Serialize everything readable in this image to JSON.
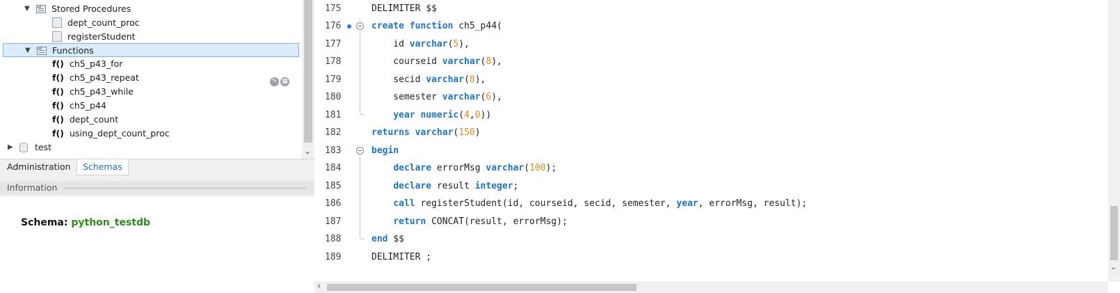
{
  "tree": {
    "stored_procedures": {
      "label": "Stored Procedures",
      "items": [
        "dept_count_proc",
        "registerStudent"
      ]
    },
    "functions": {
      "label": "Functions",
      "items": [
        "ch5_p43_for",
        "ch5_p43_repeat",
        "ch5_p43_while",
        "ch5_p44",
        "dept_count",
        "using_dept_count_proc"
      ]
    },
    "function_icon_text": "f()",
    "schema_test": "test"
  },
  "tabs": {
    "administration": "Administration",
    "schemas": "Schemas"
  },
  "information": {
    "header": "Information",
    "schema_label": "Schema:",
    "schema_value": "python_testdb"
  },
  "editor": {
    "line_numbers": [
      "175",
      "176",
      "177",
      "178",
      "179",
      "180",
      "181",
      "182",
      "183",
      "184",
      "185",
      "186",
      "187",
      "188",
      "189"
    ],
    "colors": {
      "keyword": "#1d74c2",
      "number": "#e08a19",
      "text": "#222222"
    },
    "lines": [
      [
        {
          "t": "pl",
          "v": "DELIMITER $$"
        }
      ],
      [
        {
          "t": "kw",
          "v": "create"
        },
        {
          "t": "pl",
          "v": " "
        },
        {
          "t": "kw",
          "v": "function"
        },
        {
          "t": "pl",
          "v": " ch5_p44("
        }
      ],
      [
        {
          "t": "pl",
          "v": "    id "
        },
        {
          "t": "ty",
          "v": "varchar"
        },
        {
          "t": "pl",
          "v": "("
        },
        {
          "t": "num",
          "v": "5"
        },
        {
          "t": "pl",
          "v": "),"
        }
      ],
      [
        {
          "t": "pl",
          "v": "    courseid "
        },
        {
          "t": "ty",
          "v": "varchar"
        },
        {
          "t": "pl",
          "v": "("
        },
        {
          "t": "num",
          "v": "8"
        },
        {
          "t": "pl",
          "v": "),"
        }
      ],
      [
        {
          "t": "pl",
          "v": "    secid "
        },
        {
          "t": "ty",
          "v": "varchar"
        },
        {
          "t": "pl",
          "v": "("
        },
        {
          "t": "num",
          "v": "8"
        },
        {
          "t": "pl",
          "v": "),"
        }
      ],
      [
        {
          "t": "pl",
          "v": "    semester "
        },
        {
          "t": "ty",
          "v": "varchar"
        },
        {
          "t": "pl",
          "v": "("
        },
        {
          "t": "num",
          "v": "6"
        },
        {
          "t": "pl",
          "v": "),"
        }
      ],
      [
        {
          "t": "pl",
          "v": "    "
        },
        {
          "t": "kw",
          "v": "year"
        },
        {
          "t": "pl",
          "v": " "
        },
        {
          "t": "ty",
          "v": "numeric"
        },
        {
          "t": "pl",
          "v": "("
        },
        {
          "t": "num",
          "v": "4"
        },
        {
          "t": "pl",
          "v": ","
        },
        {
          "t": "num",
          "v": "0"
        },
        {
          "t": "pl",
          "v": "))"
        }
      ],
      [
        {
          "t": "kw",
          "v": "returns"
        },
        {
          "t": "pl",
          "v": " "
        },
        {
          "t": "ty",
          "v": "varchar"
        },
        {
          "t": "pl",
          "v": "("
        },
        {
          "t": "num",
          "v": "150"
        },
        {
          "t": "pl",
          "v": ")"
        }
      ],
      [
        {
          "t": "kw",
          "v": "begin"
        }
      ],
      [
        {
          "t": "pl",
          "v": "    "
        },
        {
          "t": "kw",
          "v": "declare"
        },
        {
          "t": "pl",
          "v": " errorMsg "
        },
        {
          "t": "ty",
          "v": "varchar"
        },
        {
          "t": "pl",
          "v": "("
        },
        {
          "t": "num",
          "v": "100"
        },
        {
          "t": "pl",
          "v": ");"
        }
      ],
      [
        {
          "t": "pl",
          "v": "    "
        },
        {
          "t": "kw",
          "v": "declare"
        },
        {
          "t": "pl",
          "v": " result "
        },
        {
          "t": "ty",
          "v": "integer"
        },
        {
          "t": "pl",
          "v": ";"
        }
      ],
      [
        {
          "t": "pl",
          "v": "    "
        },
        {
          "t": "kw",
          "v": "call"
        },
        {
          "t": "pl",
          "v": " registerStudent(id, courseid, secid, semester, "
        },
        {
          "t": "kw",
          "v": "year"
        },
        {
          "t": "pl",
          "v": ", errorMsg, result);"
        }
      ],
      [
        {
          "t": "pl",
          "v": "    "
        },
        {
          "t": "kw",
          "v": "return"
        },
        {
          "t": "pl",
          "v": " CONCAT(result, errorMsg);"
        }
      ],
      [
        {
          "t": "kw",
          "v": "end"
        },
        {
          "t": "pl",
          "v": " $$"
        }
      ],
      [
        {
          "t": "pl",
          "v": "DELIMITER ;"
        }
      ]
    ]
  }
}
